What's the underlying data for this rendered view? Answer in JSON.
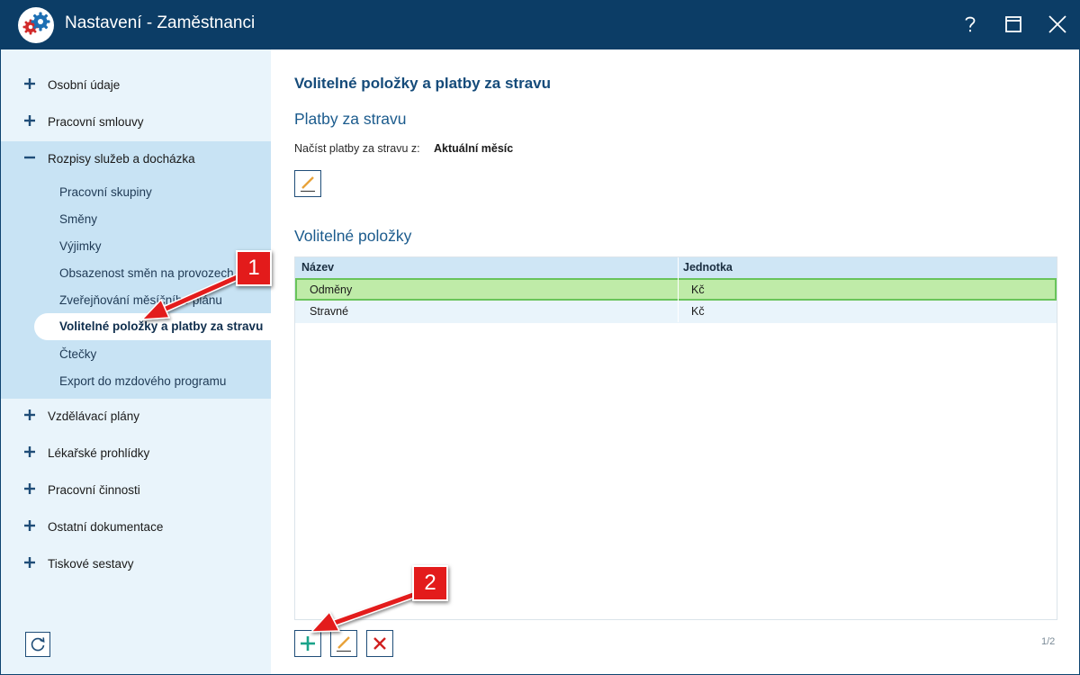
{
  "window": {
    "title": "Nastavení - Zaměstnanci",
    "help_label": "?"
  },
  "sidebar": {
    "groups": [
      {
        "label": "Osobní údaje",
        "expanded": false
      },
      {
        "label": "Pracovní smlouvy",
        "expanded": false
      },
      {
        "label": "Rozpisy služeb a docházka",
        "expanded": true
      },
      {
        "label": "Vzdělávací plány",
        "expanded": false
      },
      {
        "label": "Lékařské prohlídky",
        "expanded": false
      },
      {
        "label": "Pracovní činnosti",
        "expanded": false
      },
      {
        "label": "Ostatní dokumentace",
        "expanded": false
      },
      {
        "label": "Tiskové sestavy",
        "expanded": false
      }
    ],
    "sub_items": [
      "Pracovní skupiny",
      "Směny",
      "Výjimky",
      "Obsazenost směn na provozech",
      "Zveřejňování měsíčního plánu",
      "Volitelné položky a platby za stravu",
      "Čtečky",
      "Export do mzdového programu"
    ],
    "active_sub_item": "Volitelné položky a platby za stravu"
  },
  "main": {
    "page_title": "Volitelné položky a platby za stravu",
    "meal_section_title": "Platby za stravu",
    "load_label": "Načíst platby za stravu z:",
    "load_value": "Aktuální měsíc",
    "optional_section_title": "Volitelné položky",
    "table": {
      "columns": [
        "Název",
        "Jednotka"
      ],
      "rows": [
        {
          "name": "Odměny",
          "unit": "Kč",
          "selected": true
        },
        {
          "name": "Stravné",
          "unit": "Kč",
          "selected": false
        }
      ]
    },
    "pager": "1/2"
  },
  "annotations": {
    "callout_1": "1",
    "callout_2": "2"
  },
  "colors": {
    "titlebar": "#0c3d66",
    "accent": "#1b5b8d",
    "sidebar_bg": "#e9f4fb",
    "sidebar_expanded_bg": "#c8e3f4",
    "selected_row": "#bfeba8",
    "annotation_red": "#e31b1b",
    "add_icon": "#1aa38a",
    "delete_icon": "#d01f1f",
    "edit_icon": "#e8a23a"
  }
}
